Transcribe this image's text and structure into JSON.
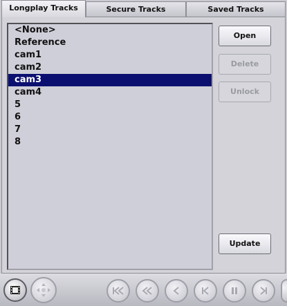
{
  "tabs": [
    {
      "label": "Longplay Tracks",
      "active": true
    },
    {
      "label": "Secure Tracks",
      "active": false
    },
    {
      "label": "Saved Tracks",
      "active": false
    }
  ],
  "tracks": [
    "<None>",
    "Reference",
    "cam1",
    "cam2",
    "cam3",
    "cam4",
    "5",
    "6",
    "7",
    "8"
  ],
  "selected_track": "cam3",
  "buttons": {
    "open": "Open",
    "delete": "Delete",
    "unlock": "Unlock",
    "update": "Update"
  },
  "toolbar_icons": [
    "film-icon",
    "directional-pad-icon",
    "skip-to-start-icon",
    "rewind-icon",
    "step-back-icon",
    "previous-frame-icon",
    "pause-icon",
    "next-frame-icon"
  ],
  "colors": {
    "selection": "#0b1070",
    "disabled_text": "#9a9aa2"
  }
}
